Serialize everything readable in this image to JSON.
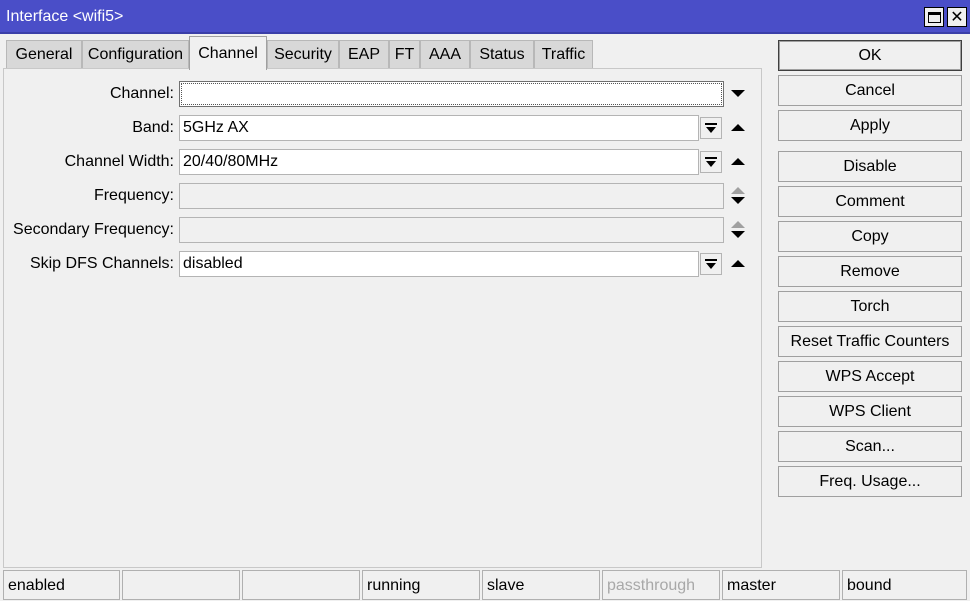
{
  "window": {
    "title": "Interface <wifi5>",
    "title_bar_color": "#4a4ec8"
  },
  "tabs": [
    {
      "label": "General",
      "active": false
    },
    {
      "label": "Configuration",
      "active": false
    },
    {
      "label": "Channel",
      "active": true
    },
    {
      "label": "Security",
      "active": false
    },
    {
      "label": "EAP",
      "active": false
    },
    {
      "label": "FT",
      "active": false
    },
    {
      "label": "AAA",
      "active": false
    },
    {
      "label": "Status",
      "active": false
    },
    {
      "label": "Traffic",
      "active": false
    }
  ],
  "form": {
    "channel": {
      "label": "Channel:",
      "value": ""
    },
    "band": {
      "label": "Band:",
      "value": "5GHz AX"
    },
    "channel_width": {
      "label": "Channel Width:",
      "value": "20/40/80MHz"
    },
    "frequency": {
      "label": "Frequency:",
      "value": ""
    },
    "secondary_frequency": {
      "label": "Secondary Frequency:",
      "value": ""
    },
    "skip_dfs_channels": {
      "label": "Skip DFS Channels:",
      "value": "disabled"
    }
  },
  "buttons": {
    "ok": "OK",
    "cancel": "Cancel",
    "apply": "Apply",
    "disable": "Disable",
    "comment": "Comment",
    "copy": "Copy",
    "remove": "Remove",
    "torch": "Torch",
    "reset_traffic_counters": "Reset Traffic Counters",
    "wps_accept": "WPS Accept",
    "wps_client": "WPS Client",
    "scan": "Scan...",
    "freq_usage": "Freq. Usage..."
  },
  "status_bar": [
    "enabled",
    "",
    "",
    "running",
    "slave",
    "passthrough",
    "master",
    "bound"
  ]
}
